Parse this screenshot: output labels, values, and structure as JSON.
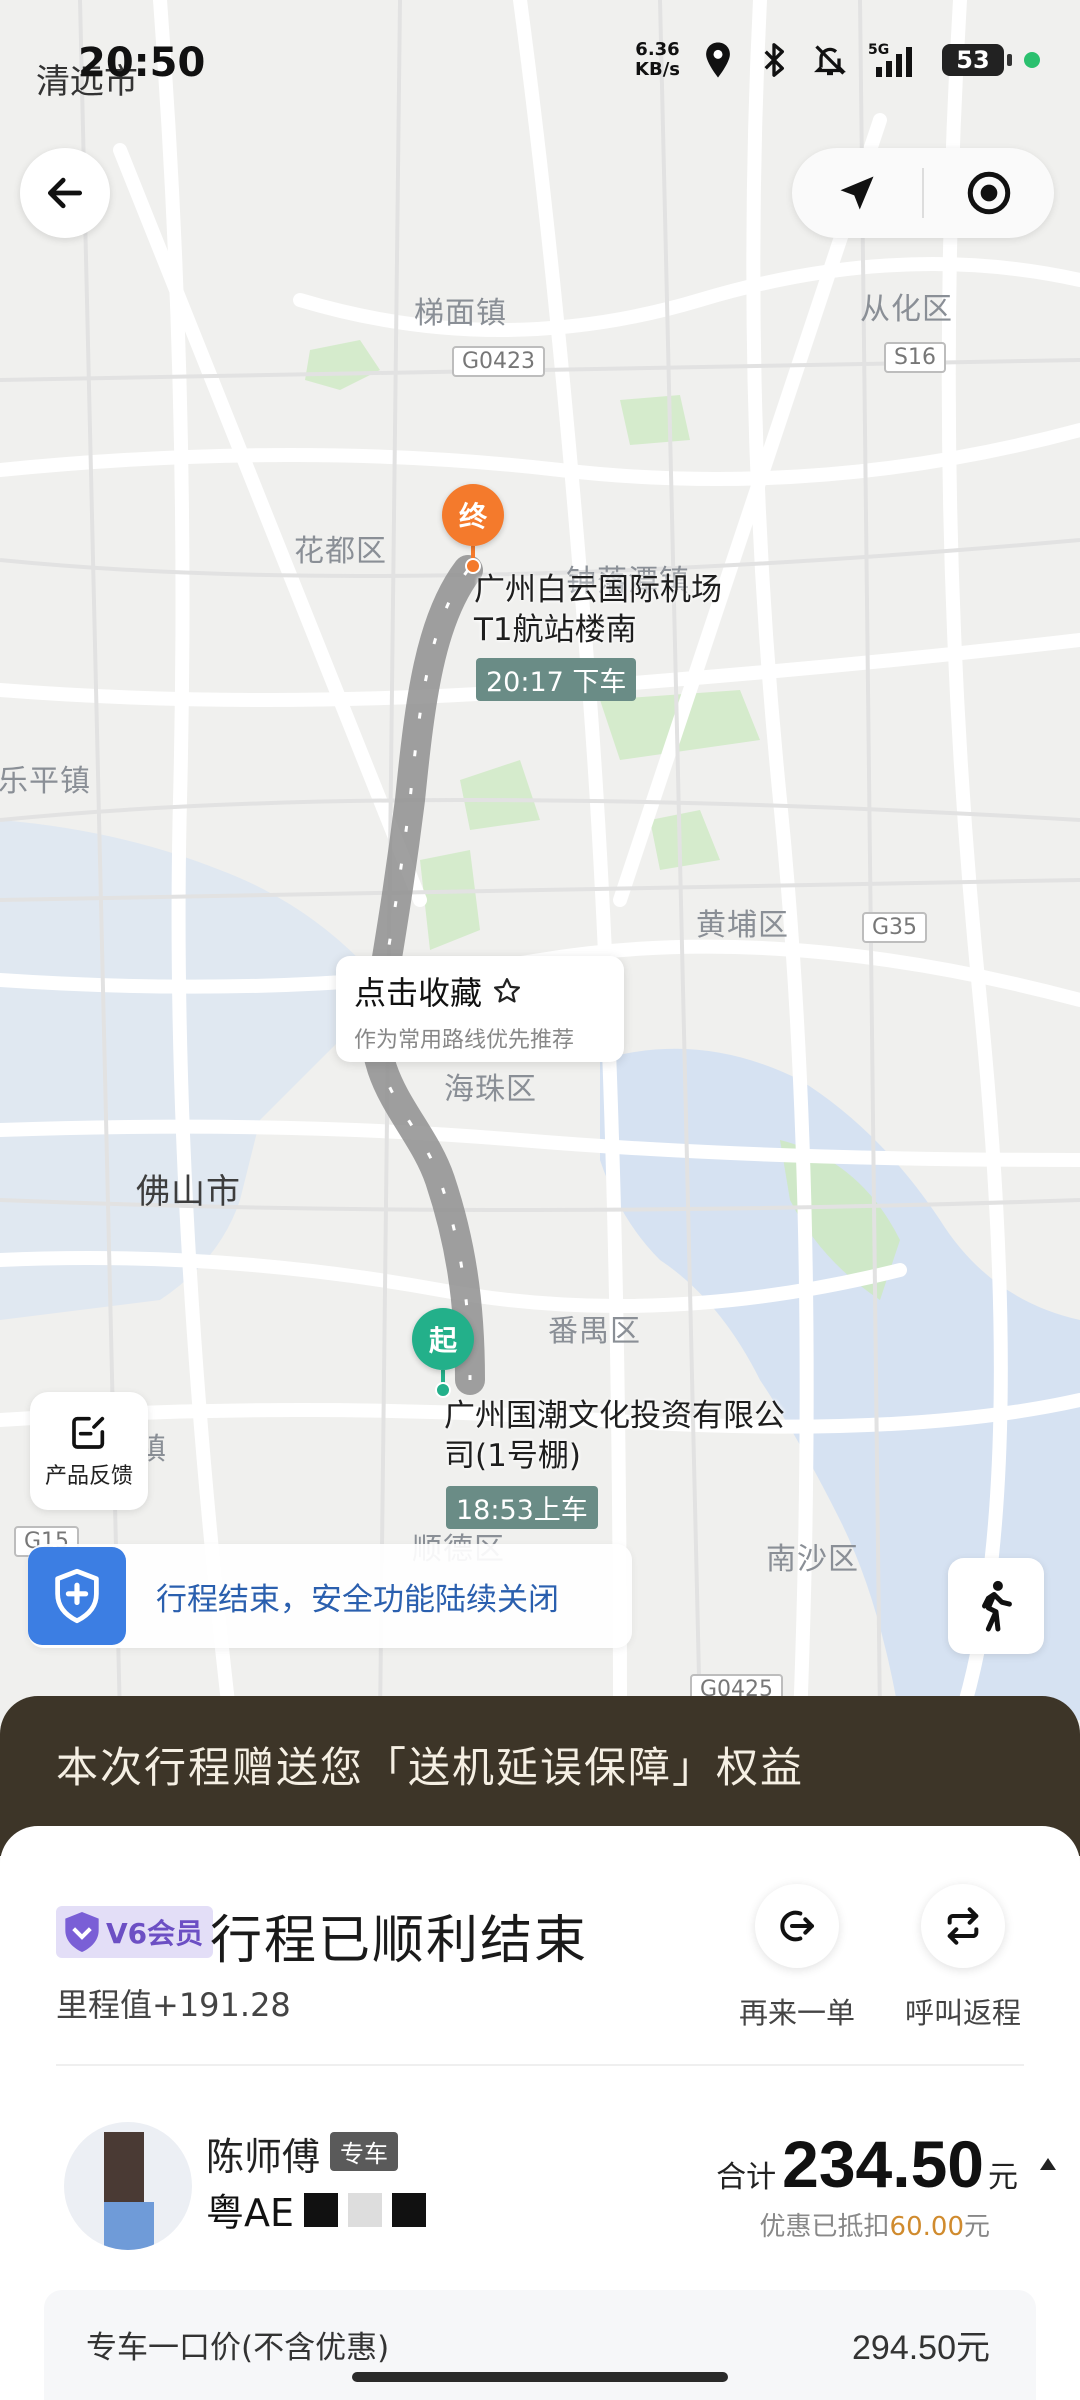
{
  "status_bar": {
    "time": "20:50",
    "city_overlay": "清远市",
    "net_speed_value": "6.36",
    "net_speed_unit": "KB/s",
    "signal": "5G",
    "battery": "53"
  },
  "map": {
    "labels": {
      "timian": "梯面镇",
      "conghua": "从化区",
      "huadu": "花都区",
      "zhongluotan": "钟落潭镇",
      "leping": "乐平镇",
      "huangpu": "黄埔区",
      "haizhu": "海珠区",
      "foshan": "佛山市",
      "panyu": "番禺区",
      "nansha": "南沙区",
      "shunde": "顺德区",
      "zhen": "镇"
    },
    "shields": {
      "g0423": "G0423",
      "s16": "S16",
      "g35": "G35",
      "g15": "G15",
      "g0425": "G0425"
    },
    "end_pin": "终",
    "end_place_line1": "广州白云国际机场",
    "end_place_line2": "T1航站楼南",
    "end_time": "20:17 下车",
    "start_pin": "起",
    "start_place_line1": "广州国潮文化投资有限公",
    "start_place_line2": "司(1号棚)",
    "start_time": "18:53上车",
    "favorite_title": "点击收藏",
    "favorite_sub": "作为常用路线优先推荐",
    "feedback_label": "产品反馈",
    "safety_text": "行程结束，安全功能陆续关闭"
  },
  "promo": {
    "text": "本次行程赠送您「送机延误保障」权益"
  },
  "trip": {
    "vip_label": "V6会员",
    "title": "行程已顺利结束",
    "mileage": "里程值+191.28",
    "actions": [
      {
        "label": "再来一单",
        "icon": "reorder-icon"
      },
      {
        "label": "呼叫返程",
        "icon": "return-trip-icon"
      }
    ],
    "driver_name": "陈师傅",
    "driver_tag": "专车",
    "plate_prefix": "粤AE",
    "price_label": "合计",
    "price": "234.50",
    "price_unit": "元",
    "discount_prefix": "优惠已抵扣",
    "discount_amount": "60.00",
    "discount_unit": "元",
    "fare_item_name": "专车一口价(不含优惠)",
    "fare_item_value": "294.50元"
  },
  "colors": {
    "end_pin": "#f47a2c",
    "start_pin": "#23b08a",
    "safety_blue": "#3c7ee3",
    "promo_bg": "#3d3528",
    "vip_purple": "#6c4fc4",
    "discount_orange": "#d08b2e"
  }
}
